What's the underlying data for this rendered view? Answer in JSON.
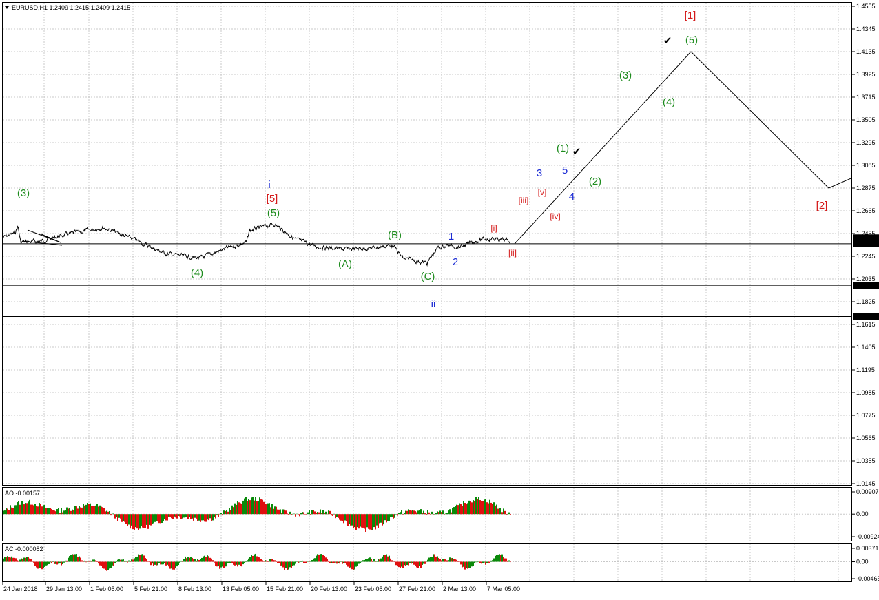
{
  "window": {
    "header": "EURUSD,H1  1.2409 1.2415 1.2409 1.2415"
  },
  "colors": {
    "wave_green": "#1e8c1e",
    "wave_red": "#d41a1a",
    "wave_blue": "#1a2ad4",
    "ao_green": "#0a8a0a",
    "ao_red": "#e01010"
  },
  "main": {
    "price_ticks": [
      "1.4555",
      "1.4345",
      "1.4135",
      "1.3925",
      "1.3715",
      "1.3505",
      "1.3295",
      "1.3085",
      "1.2875",
      "1.2665",
      "1.2455",
      "1.2245",
      "1.2035",
      "1.1825",
      "1.1615",
      "1.1405",
      "1.1195",
      "1.0985",
      "1.0775",
      "1.0565",
      "1.0355",
      "1.0145"
    ],
    "levels": [
      {
        "label": "1.2415",
        "price": 1.2415,
        "line": false
      },
      {
        "label": "1.2360",
        "price": 1.236,
        "line": true
      },
      {
        "label": "1.1977",
        "price": 1.1977,
        "line": true
      },
      {
        "label": "1.1688",
        "price": 1.1688,
        "line": true
      }
    ],
    "wave_labels": [
      {
        "text": "(3)",
        "color": "green"
      },
      {
        "text": "(4)",
        "color": "green"
      },
      {
        "text": "i",
        "color": "blue"
      },
      {
        "text": "[5]",
        "color": "red"
      },
      {
        "text": "(5)",
        "color": "green"
      },
      {
        "text": "(A)",
        "color": "green"
      },
      {
        "text": "(B)",
        "color": "green"
      },
      {
        "text": "(C)",
        "color": "green"
      },
      {
        "text": "ii",
        "color": "blue"
      },
      {
        "text": "1",
        "color": "blue"
      },
      {
        "text": "2",
        "color": "blue"
      },
      {
        "text": "[i]",
        "color": "red"
      },
      {
        "text": "[ii]",
        "color": "red"
      },
      {
        "text": "[iii]",
        "color": "red"
      },
      {
        "text": "[iv]",
        "color": "red"
      },
      {
        "text": "[v]",
        "color": "red"
      },
      {
        "text": "3",
        "color": "blue"
      },
      {
        "text": "4",
        "color": "blue"
      },
      {
        "text": "5",
        "color": "blue"
      },
      {
        "text": "(1)",
        "color": "green"
      },
      {
        "text": "(2)",
        "color": "green"
      },
      {
        "text": "(3)",
        "color": "green"
      },
      {
        "text": "(4)",
        "color": "green"
      },
      {
        "text": "(5)",
        "color": "green"
      },
      {
        "text": "[1]",
        "color": "red"
      },
      {
        "text": "[2]",
        "color": "red"
      },
      {
        "text": "✔",
        "color": "black"
      },
      {
        "text": "✔",
        "color": "black"
      }
    ],
    "projection_prices": [
      1.236,
      1.4135,
      1.2875,
      1.2966
    ]
  },
  "ao": {
    "label": "AO -0.00157",
    "ticks": [
      "0.00907",
      "0.00",
      "-0.00924"
    ],
    "max": 0.00907,
    "min": -0.00924
  },
  "ac": {
    "label": "AC -0.000082",
    "ticks": [
      "0.00371",
      "0.00",
      "-0.00465"
    ],
    "max": 0.00371,
    "min": -0.00465
  },
  "time_ticks": [
    "24 Jan 2018",
    "29 Jan 13:00",
    "1 Feb 05:00",
    "5 Feb 21:00",
    "8 Feb 13:00",
    "13 Feb 05:00",
    "15 Feb 21:00",
    "20 Feb 13:00",
    "23 Feb 05:00",
    "27 Feb 21:00",
    "2 Mar 13:00",
    "7 Mar 05:00"
  ]
}
